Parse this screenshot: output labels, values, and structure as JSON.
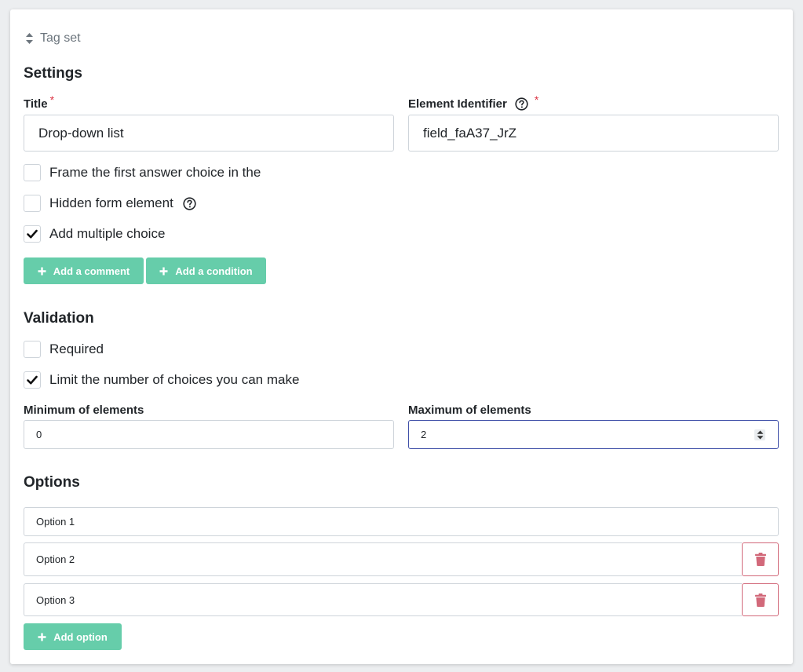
{
  "header": {
    "tagset_label": "Tag set",
    "icon": "sort-icon"
  },
  "settings": {
    "title": "Settings",
    "title_field": {
      "label": "Title",
      "required_mark": "*",
      "value": "Drop-down list"
    },
    "identifier_field": {
      "label": "Element Identifier",
      "required_mark": "*",
      "value": "field_faA37_JrZ",
      "help_icon": "question-circle-icon"
    },
    "checkboxes": [
      {
        "label": "Frame the first answer choice in the",
        "checked": false
      },
      {
        "label": "Hidden form element",
        "checked": false,
        "help_icon": "question-circle-icon"
      },
      {
        "label": "Add multiple choice",
        "checked": true
      }
    ],
    "buttons": {
      "add_comment": "Add a comment",
      "add_condition": "Add a condition"
    }
  },
  "validation": {
    "title": "Validation",
    "checkboxes": [
      {
        "label": "Required",
        "checked": false
      },
      {
        "label": "Limit the number of choices you can make",
        "checked": true
      }
    ],
    "min_field": {
      "label": "Minimum of elements",
      "value": "0"
    },
    "max_field": {
      "label": "Maximum of elements",
      "value": "2"
    }
  },
  "options": {
    "title": "Options",
    "items": [
      {
        "value": "Option 1",
        "deletable": false
      },
      {
        "value": "Option 2",
        "deletable": true
      },
      {
        "value": "Option 3",
        "deletable": true
      }
    ],
    "add_option": "Add option"
  },
  "colors": {
    "accent": "#66cdaa",
    "danger": "#d2697a",
    "required": "#dc3545",
    "focus": "#3f4fa8"
  }
}
